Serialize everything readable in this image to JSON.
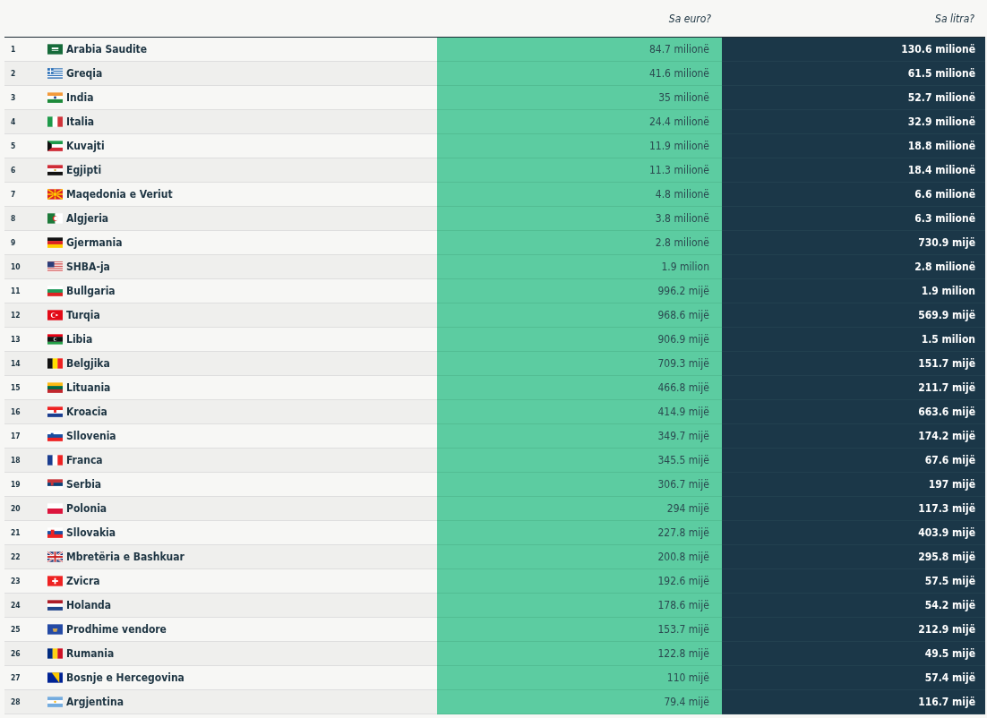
{
  "columns": {
    "euro": "Sa euro?",
    "litre": "Sa litra?"
  },
  "rows": [
    {
      "rank": "1",
      "kind": "sa",
      "country": "Arabia Saudite",
      "euro": "84.7 milionë",
      "litre": "130.6 milionë"
    },
    {
      "rank": "2",
      "kind": "gr",
      "country": "Greqia",
      "euro": "41.6 milionë",
      "litre": "61.5 milionë"
    },
    {
      "rank": "3",
      "kind": "in",
      "country": "India",
      "euro": "35 milionë",
      "litre": "52.7 milionë"
    },
    {
      "rank": "4",
      "kind": "it",
      "country": "Italia",
      "euro": "24.4 milionë",
      "litre": "32.9 milionë"
    },
    {
      "rank": "5",
      "kind": "kw",
      "country": "Kuvajti",
      "euro": "11.9 milionë",
      "litre": "18.8 milionë"
    },
    {
      "rank": "6",
      "kind": "eg",
      "country": "Egjipti",
      "euro": "11.3 milionë",
      "litre": "18.4 milionë"
    },
    {
      "rank": "7",
      "kind": "mk",
      "country": "Maqedonia e Veriut",
      "euro": "4.8 milionë",
      "litre": "6.6 milionë"
    },
    {
      "rank": "8",
      "kind": "dz",
      "country": "Algjeria",
      "euro": "3.8 milionë",
      "litre": "6.3 milionë"
    },
    {
      "rank": "9",
      "kind": "de",
      "country": "Gjermania",
      "euro": "2.8 milionë",
      "litre": "730.9 mijë"
    },
    {
      "rank": "10",
      "kind": "us",
      "country": "SHBA-ja",
      "euro": "1.9 milion",
      "litre": "2.8 milionë"
    },
    {
      "rank": "11",
      "kind": "bg",
      "country": "Bullgaria",
      "euro": "996.2 mijë",
      "litre": "1.9 milion"
    },
    {
      "rank": "12",
      "kind": "tr",
      "country": "Turqia",
      "euro": "968.6 mijë",
      "litre": "569.9 mijë"
    },
    {
      "rank": "13",
      "kind": "ly",
      "country": "Libia",
      "euro": "906.9 mijë",
      "litre": "1.5 milion"
    },
    {
      "rank": "14",
      "kind": "be",
      "country": "Belgjika",
      "euro": "709.3 mijë",
      "litre": "151.7 mijë"
    },
    {
      "rank": "15",
      "kind": "lt",
      "country": "Lituania",
      "euro": "466.8 mijë",
      "litre": "211.7 mijë"
    },
    {
      "rank": "16",
      "kind": "hr",
      "country": "Kroacia",
      "euro": "414.9 mijë",
      "litre": "663.6 mijë"
    },
    {
      "rank": "17",
      "kind": "si",
      "country": "Sllovenia",
      "euro": "349.7 mijë",
      "litre": "174.2 mijë"
    },
    {
      "rank": "18",
      "kind": "fr",
      "country": "Franca",
      "euro": "345.5 mijë",
      "litre": "67.6 mijë"
    },
    {
      "rank": "19",
      "kind": "rs",
      "country": "Serbia",
      "euro": "306.7 mijë",
      "litre": "197 mijë"
    },
    {
      "rank": "20",
      "kind": "pl",
      "country": "Polonia",
      "euro": "294 mijë",
      "litre": "117.3 mijë"
    },
    {
      "rank": "21",
      "kind": "sk",
      "country": "Sllovakia",
      "euro": "227.8 mijë",
      "litre": "403.9 mijë"
    },
    {
      "rank": "22",
      "kind": "gb",
      "country": "Mbretëria e Bashkuar",
      "euro": "200.8 mijë",
      "litre": "295.8 mijë"
    },
    {
      "rank": "23",
      "kind": "ch",
      "country": "Zvicra",
      "euro": "192.6 mijë",
      "litre": "57.5 mijë"
    },
    {
      "rank": "24",
      "kind": "nl",
      "country": "Holanda",
      "euro": "178.6 mijë",
      "litre": "54.2 mijë"
    },
    {
      "rank": "25",
      "kind": "xk",
      "country": "Prodhime vendore",
      "euro": "153.7 mijë",
      "litre": "212.9 mijë"
    },
    {
      "rank": "26",
      "kind": "ro",
      "country": "Rumania",
      "euro": "122.8 mijë",
      "litre": "49.5 mijë"
    },
    {
      "rank": "27",
      "kind": "ba",
      "country": "Bosnje e Hercegovina",
      "euro": "110 mijë",
      "litre": "57.4 mijë"
    },
    {
      "rank": "28",
      "kind": "ar",
      "country": "Argjentina",
      "euro": "79.4 mijë",
      "litre": "116.7 mijë"
    }
  ]
}
